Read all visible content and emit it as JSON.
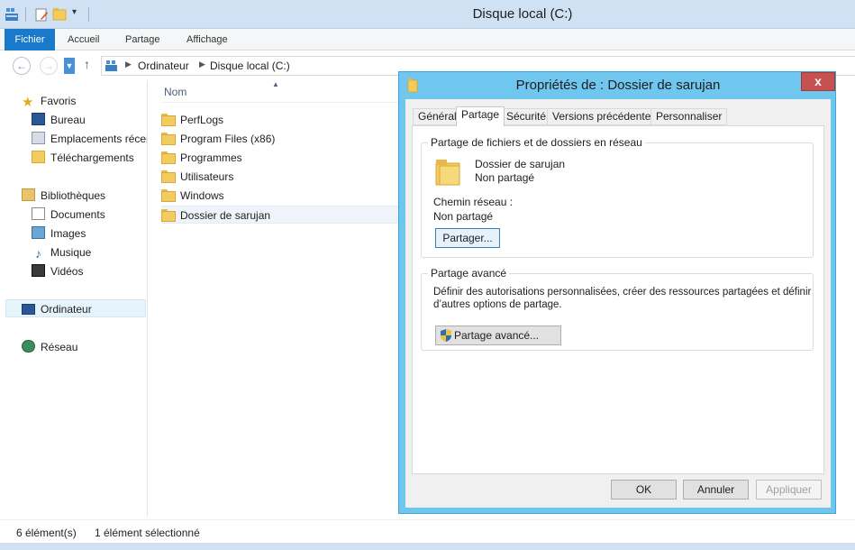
{
  "window": {
    "title": "Disque local (C:)"
  },
  "ribbon": {
    "tabs": [
      "Fichier",
      "Accueil",
      "Partage",
      "Affichage"
    ]
  },
  "address": {
    "segments": [
      "Ordinateur",
      "Disque local (C:)"
    ]
  },
  "nav": {
    "favorites": {
      "label": "Favoris",
      "items": [
        "Bureau",
        "Emplacements récents",
        "Téléchargements"
      ]
    },
    "libraries": {
      "label": "Bibliothèques",
      "items": [
        "Documents",
        "Images",
        "Musique",
        "Vidéos"
      ]
    },
    "computer": "Ordinateur",
    "network": "Réseau"
  },
  "filelist": {
    "column_name": "Nom",
    "files": [
      "PerfLogs",
      "Program Files (x86)",
      "Programmes",
      "Utilisateurs",
      "Windows",
      "Dossier de sarujan"
    ]
  },
  "status": {
    "count": "6 élément(s)",
    "selection": "1 élément sélectionné"
  },
  "dialog": {
    "title": "Propriétés de : Dossier de sarujan",
    "close": "x",
    "tabs": [
      "Général",
      "Partage",
      "Sécurité",
      "Versions précédentes",
      "Personnaliser"
    ],
    "active_tab": "Partage",
    "network_group": {
      "label": "Partage de fichiers et de dossiers en réseau",
      "folder_name": "Dossier de sarujan",
      "folder_state": "Non partagé",
      "path_label": "Chemin réseau :",
      "path_value": "Non partagé",
      "share_button": "Partager..."
    },
    "advanced_group": {
      "label": "Partage avancé",
      "description_1": "Définir des autorisations personnalisées, créer des ressources partagées et définir",
      "description_2": "d’autres options de partage.",
      "button": "Partage avancé..."
    },
    "buttons": {
      "ok": "OK",
      "cancel": "Annuler",
      "apply": "Appliquer"
    }
  }
}
